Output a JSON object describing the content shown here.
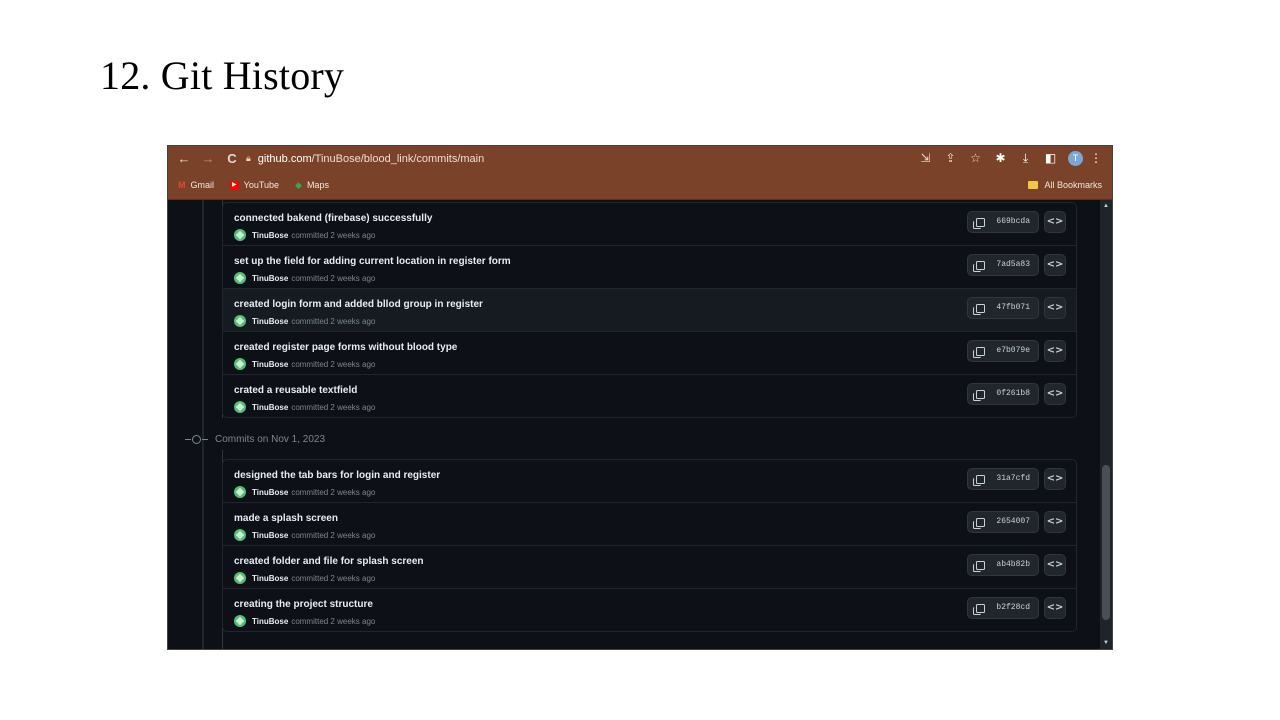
{
  "slide": {
    "title": "12. Git History"
  },
  "browser": {
    "url_host": "github.com",
    "url_path": "/TinuBose/blood_link/commits/main",
    "nav": {
      "back": "←",
      "forward": "→",
      "reload": "C"
    },
    "toolbar_icons": [
      "⇲",
      "⇪",
      "☆",
      "✱",
      "⤓",
      "◧"
    ],
    "profile_initial": "T",
    "menu_glyph": "⋮",
    "bookmarks": [
      {
        "label": "Gmail",
        "icon": "M",
        "color": "#ea4335"
      },
      {
        "label": "YouTube",
        "icon": "▶",
        "color": "#ff0000"
      },
      {
        "label": "Maps",
        "icon": "◆",
        "color": "#34a853"
      }
    ],
    "all_bookmarks": "All Bookmarks"
  },
  "groups": [
    {
      "heading": "",
      "commits": [
        {
          "message": "connected bakend (firebase) successfully",
          "author": "TinuBose",
          "when": "committed 2 weeks ago",
          "sha": "669bcda",
          "highlighted": false
        },
        {
          "message": "set up the field for adding current location in register form",
          "author": "TinuBose",
          "when": "committed 2 weeks ago",
          "sha": "7ad5a83",
          "highlighted": false
        },
        {
          "message": "created login form and added bllod group in register",
          "author": "TinuBose",
          "when": "committed 2 weeks ago",
          "sha": "47fb071",
          "highlighted": true
        },
        {
          "message": "created register page forms without blood type",
          "author": "TinuBose",
          "when": "committed 2 weeks ago",
          "sha": "e7b079e",
          "highlighted": false
        },
        {
          "message": "crated a reusable textfield",
          "author": "TinuBose",
          "when": "committed 2 weeks ago",
          "sha": "0f261b8",
          "highlighted": false
        }
      ]
    },
    {
      "heading": "Commits on Nov 1, 2023",
      "commits": [
        {
          "message": "designed the tab bars for login and register",
          "author": "TinuBose",
          "when": "committed 2 weeks ago",
          "sha": "31a7cfd",
          "highlighted": false
        },
        {
          "message": "made a splash screen",
          "author": "TinuBose",
          "when": "committed 2 weeks ago",
          "sha": "2654007",
          "highlighted": false
        },
        {
          "message": "created folder and file for splash screen",
          "author": "TinuBose",
          "when": "committed 2 weeks ago",
          "sha": "ab4b82b",
          "highlighted": false
        },
        {
          "message": "creating the project structure",
          "author": "TinuBose",
          "when": "committed 2 weeks ago",
          "sha": "b2f28cd",
          "highlighted": false
        }
      ]
    }
  ],
  "icons": {
    "copy": "copy-icon",
    "browse": "code-icon",
    "code_glyph": "<>"
  }
}
